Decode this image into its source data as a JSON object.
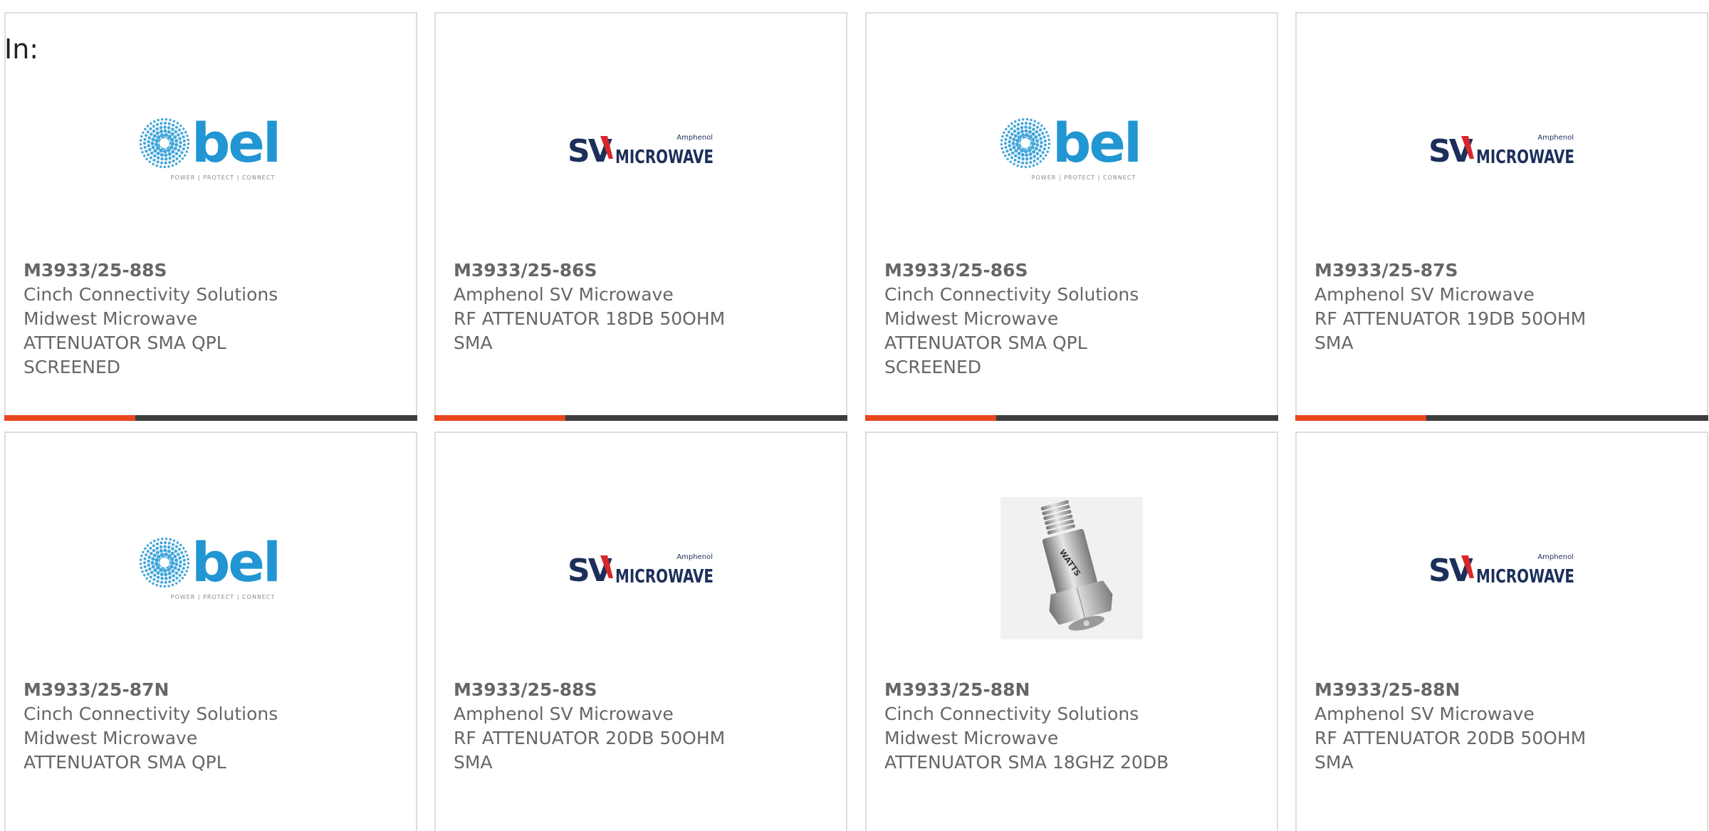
{
  "header": {
    "in_label": "In:"
  },
  "colors": {
    "accent": "#e8461e",
    "bar": "#3d3d3d",
    "bel_blue": "#2196d3",
    "sv_navy": "#1c2f5a",
    "sv_red": "#d8262c"
  },
  "cards": [
    {
      "logo": "bel-logo",
      "part_number": "M3933/25-88S",
      "lines": [
        "Cinch Connectivity Solutions",
        "Midwest Microwave",
        "ATTENUATOR SMA QPL",
        "SCREENED"
      ]
    },
    {
      "logo": "sv-microwave-logo",
      "part_number": "M3933/25-86S",
      "lines": [
        "Amphenol SV Microwave",
        "RF ATTENUATOR 18DB 50OHM",
        "SMA"
      ]
    },
    {
      "logo": "bel-logo",
      "part_number": "M3933/25-86S",
      "lines": [
        "Cinch Connectivity Solutions",
        "Midwest Microwave",
        "ATTENUATOR SMA QPL",
        "SCREENED"
      ]
    },
    {
      "logo": "sv-microwave-logo",
      "part_number": "M3933/25-87S",
      "lines": [
        "Amphenol SV Microwave",
        "RF ATTENUATOR 19DB 50OHM",
        "SMA"
      ]
    },
    {
      "logo": "bel-logo",
      "part_number": "M3933/25-87N",
      "lines": [
        "Cinch Connectivity Solutions",
        "Midwest Microwave",
        "ATTENUATOR SMA QPL"
      ]
    },
    {
      "logo": "sv-microwave-logo",
      "part_number": "M3933/25-88S",
      "lines": [
        "Amphenol SV Microwave",
        "RF ATTENUATOR 20DB 50OHM",
        "SMA"
      ]
    },
    {
      "logo": "attenuator-photo",
      "part_number": "M3933/25-88N",
      "lines": [
        "Cinch Connectivity Solutions",
        "Midwest Microwave",
        "ATTENUATOR SMA 18GHZ 20DB"
      ]
    },
    {
      "logo": "sv-microwave-logo",
      "part_number": "M3933/25-88N",
      "lines": [
        "Amphenol SV Microwave",
        "RF ATTENUATOR 20DB 50OHM",
        "SMA"
      ]
    }
  ],
  "logos": {
    "bel": {
      "wordmark": "bel",
      "tagline": "POWER | PROTECT | CONNECT"
    },
    "sv": {
      "mark": "SV",
      "wordmark": "MICROWAVE",
      "brand": "Amphenol"
    },
    "photo": {
      "marking": "WATTS"
    }
  }
}
